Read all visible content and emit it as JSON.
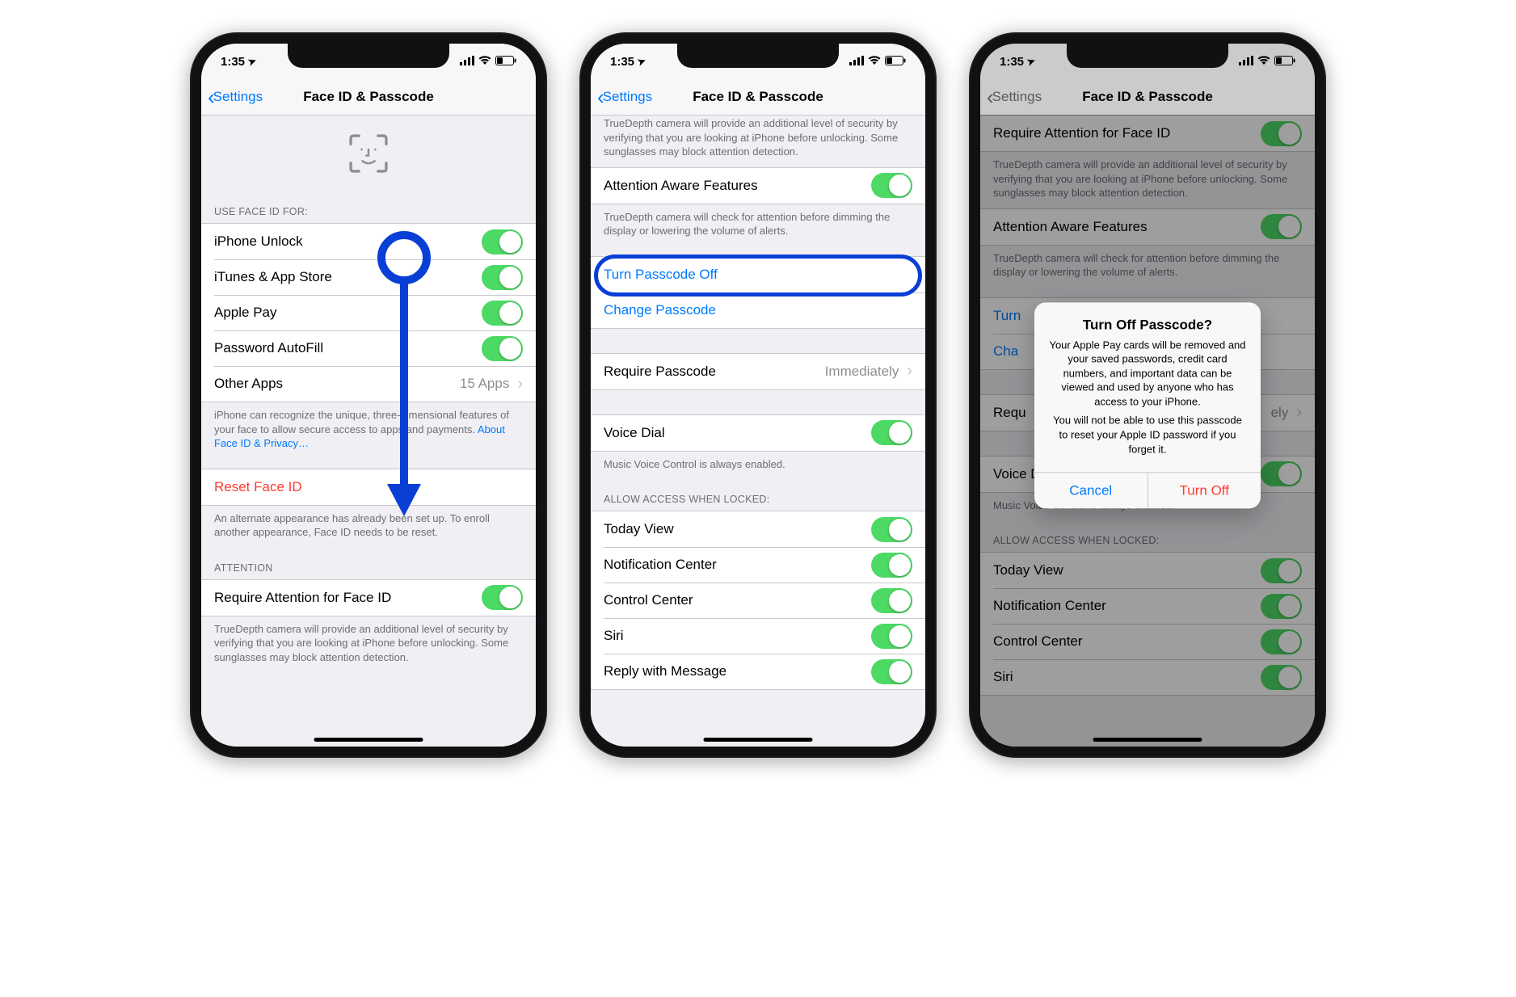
{
  "status": {
    "time": "1:35",
    "loc_glyph": "➤"
  },
  "nav": {
    "back": "Settings",
    "title": "Face ID & Passcode"
  },
  "p1": {
    "sec_use": "USE FACE ID FOR:",
    "rows": {
      "unlock": "iPhone Unlock",
      "itunes": "iTunes & App Store",
      "applepay": "Apple Pay",
      "autofill": "Password AutoFill",
      "other": "Other Apps",
      "other_val": "15 Apps"
    },
    "footer_use": "iPhone can recognize the unique, three-dimensional features of your face to allow secure access to apps and payments. ",
    "footer_use_link": "About Face ID & Privacy…",
    "reset": "Reset Face ID",
    "footer_reset": "An alternate appearance has already been set up. To enroll another appearance, Face ID needs to be reset.",
    "sec_attn": "ATTENTION",
    "req_attn": "Require Attention for Face ID",
    "footer_attn": "TrueDepth camera will provide an additional level of security by verifying that you are looking at iPhone before unlocking. Some sunglasses may block attention detection."
  },
  "p2": {
    "footer_top": "TrueDepth camera will provide an additional level of security by verifying that you are looking at iPhone before unlocking. Some sunglasses may block attention detection.",
    "aware": "Attention Aware Features",
    "footer_aware": "TrueDepth camera will check for attention before dimming the display or lowering the volume of alerts.",
    "turnoff": "Turn Passcode Off",
    "change": "Change Passcode",
    "require": "Require Passcode",
    "require_val": "Immediately",
    "voice": "Voice Dial",
    "footer_voice": "Music Voice Control is always enabled.",
    "sec_allow": "ALLOW ACCESS WHEN LOCKED:",
    "today": "Today View",
    "notif": "Notification Center",
    "cc": "Control Center",
    "siri": "Siri",
    "reply": "Reply with Message"
  },
  "p3": {
    "req_attn": "Require Attention for Face ID",
    "footer_attn": "TrueDepth camera will provide an additional level of security by verifying that you are looking at iPhone before unlocking. Some sunglasses may block attention detection.",
    "aware": "Attention Aware Features",
    "footer_aware": "TrueDepth camera will check for attention before dimming the display or lowering the volume of alerts.",
    "turnoff_peek": "Turn",
    "change_peek": "Cha",
    "require_peek_label": "Requ",
    "require_peek_val": "ely",
    "voice": "Voice Dial",
    "footer_voice": "Music Voice Control is always enabled.",
    "sec_allow": "ALLOW ACCESS WHEN LOCKED:",
    "today": "Today View",
    "notif": "Notification Center",
    "cc": "Control Center",
    "siri": "Siri"
  },
  "alert": {
    "title": "Turn Off Passcode?",
    "msg1": "Your Apple Pay cards will be removed and your saved passwords, credit card numbers, and important data can be viewed and used by anyone who has access to your iPhone.",
    "msg2": "You will not be able to use this passcode to reset your Apple ID password if you forget it.",
    "cancel": "Cancel",
    "turn_off": "Turn Off"
  }
}
